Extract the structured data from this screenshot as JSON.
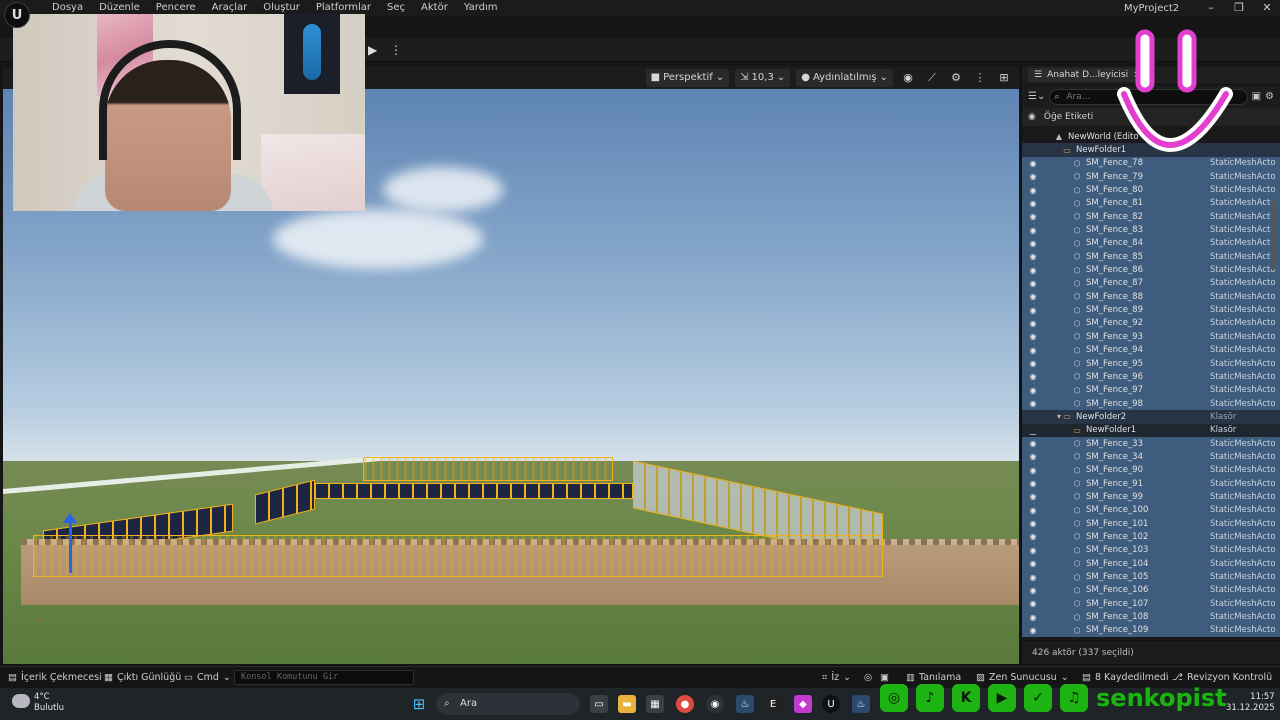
{
  "app": {
    "project_name": "MyProject2",
    "menu": [
      "Dosya",
      "Düzenle",
      "Pencere",
      "Araçlar",
      "Oluştur",
      "Platformlar",
      "Seç",
      "Aktör",
      "Yardım"
    ],
    "window_controls": [
      "–",
      "❐",
      "✕"
    ]
  },
  "viewport": {
    "view_mode": "Perspektif",
    "fov_value": "10,3",
    "lighting_mode": "Aydınlatılmış"
  },
  "outliner": {
    "tab_label": "Anahat D...leyicisi",
    "search_placeholder": "Ara...",
    "column_label": "Öğe Etiketi",
    "world_label": "NewWorld (Edito",
    "folder1_label": "NewFolder1",
    "rows_a": [
      {
        "name": "SM_Fence_78",
        "type": "StaticMeshActo"
      },
      {
        "name": "SM_Fence_79",
        "type": "StaticMeshActo"
      },
      {
        "name": "SM_Fence_80",
        "type": "StaticMeshActo"
      },
      {
        "name": "SM_Fence_81",
        "type": "StaticMeshActo"
      },
      {
        "name": "SM_Fence_82",
        "type": "StaticMeshActo"
      },
      {
        "name": "SM_Fence_83",
        "type": "StaticMeshActo"
      },
      {
        "name": "SM_Fence_84",
        "type": "StaticMeshActo"
      },
      {
        "name": "SM_Fence_85",
        "type": "StaticMeshActo"
      },
      {
        "name": "SM_Fence_86",
        "type": "StaticMeshActo"
      },
      {
        "name": "SM_Fence_87",
        "type": "StaticMeshActo"
      },
      {
        "name": "SM_Fence_88",
        "type": "StaticMeshActo"
      },
      {
        "name": "SM_Fence_89",
        "type": "StaticMeshActo"
      },
      {
        "name": "SM_Fence_92",
        "type": "StaticMeshActo"
      },
      {
        "name": "SM_Fence_93",
        "type": "StaticMeshActo"
      },
      {
        "name": "SM_Fence_94",
        "type": "StaticMeshActo"
      },
      {
        "name": "SM_Fence_95",
        "type": "StaticMeshActo"
      },
      {
        "name": "SM_Fence_96",
        "type": "StaticMeshActo"
      },
      {
        "name": "SM_Fence_97",
        "type": "StaticMeshActo"
      },
      {
        "name": "SM_Fence_98",
        "type": "StaticMeshActo"
      }
    ],
    "folder2": {
      "name": "NewFolder2",
      "type": "Klasör"
    },
    "folder2_sub": {
      "name": "NewFolder1",
      "type": "Klasör"
    },
    "rows_b": [
      {
        "name": "SM_Fence_33",
        "type": "StaticMeshActo"
      },
      {
        "name": "SM_Fence_34",
        "type": "StaticMeshActo"
      },
      {
        "name": "SM_Fence_90",
        "type": "StaticMeshActo"
      },
      {
        "name": "SM_Fence_91",
        "type": "StaticMeshActo"
      },
      {
        "name": "SM_Fence_99",
        "type": "StaticMeshActo"
      },
      {
        "name": "SM_Fence_100",
        "type": "StaticMeshActo"
      },
      {
        "name": "SM_Fence_101",
        "type": "StaticMeshActo"
      },
      {
        "name": "SM_Fence_102",
        "type": "StaticMeshActo"
      },
      {
        "name": "SM_Fence_103",
        "type": "StaticMeshActo"
      },
      {
        "name": "SM_Fence_104",
        "type": "StaticMeshActo"
      },
      {
        "name": "SM_Fence_105",
        "type": "StaticMeshActo"
      },
      {
        "name": "SM_Fence_106",
        "type": "StaticMeshActo"
      },
      {
        "name": "SM_Fence_107",
        "type": "StaticMeshActo"
      },
      {
        "name": "SM_Fence_108",
        "type": "StaticMeshActo"
      },
      {
        "name": "SM_Fence_109",
        "type": "StaticMeshActo"
      }
    ],
    "footer": "426 aktör (337 seçildi)"
  },
  "statusbar": {
    "content_drawer": "İçerik Çekmecesi",
    "output_log": "Çıktı Günlüğü",
    "cmd": "Cmd",
    "console_placeholder": "Konsol Komutunu Gir",
    "trace": "İz",
    "derived_data": "Tanılama",
    "zen": "Zen Sunucusu",
    "unsaved": "8 Kaydedilmedi",
    "revision": "Revizyon Kontrolü"
  },
  "taskbar": {
    "temperature": "4°C",
    "weather": "Bulutlu",
    "search": "Ara",
    "time": "11:57",
    "date": "31.12.2025"
  },
  "social": {
    "handle": "senkopist"
  },
  "colors": {
    "selection": "#f2b21a",
    "row_selected": "#3e5c7e",
    "social_green": "#1db313",
    "smiley_pink": "#e23fd0"
  }
}
